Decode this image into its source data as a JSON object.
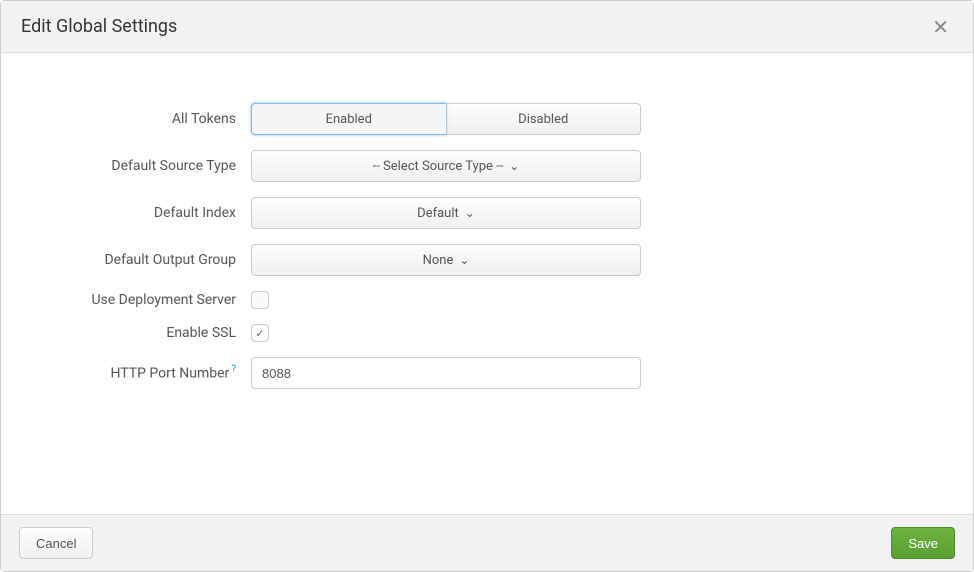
{
  "header": {
    "title": "Edit Global Settings"
  },
  "form": {
    "all_tokens": {
      "label": "All Tokens",
      "enabled": "Enabled",
      "disabled": "Disabled"
    },
    "default_source_type": {
      "label": "Default Source Type",
      "value": "-- Select Source Type --"
    },
    "default_index": {
      "label": "Default Index",
      "value": "Default"
    },
    "default_output_group": {
      "label": "Default Output Group",
      "value": "None"
    },
    "use_deployment_server": {
      "label": "Use Deployment Server"
    },
    "enable_ssl": {
      "label": "Enable SSL"
    },
    "http_port": {
      "label": "HTTP Port Number",
      "help": "?",
      "value": "8088"
    }
  },
  "footer": {
    "cancel": "Cancel",
    "save": "Save"
  }
}
